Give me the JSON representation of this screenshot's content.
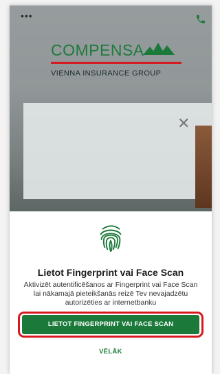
{
  "header": {
    "menu_icon": "more-dots-icon",
    "phone_icon": "phone-icon"
  },
  "brand": {
    "name": "COMPENSA",
    "subtitle": "VIENNA INSURANCE GROUP",
    "primary_color": "#1b7a3a",
    "accent_color": "#d6191f"
  },
  "background_dialog": {
    "close_icon": "close-icon"
  },
  "sheet": {
    "icon": "fingerprint-icon",
    "title": "Lietot Fingerprint vai Face Scan",
    "description": "Aktivizēt autentificēšanos ar Fingerprint vai Face Scan lai nākamajā pieteikšanās reizē Tev nevajadzētu autorizēties ar internetbanku",
    "primary_button": "LIETOT FINGERPRINT VAI FACE SCAN",
    "secondary_link": "VĒLĀK",
    "highlight_color": "#d6191f"
  }
}
